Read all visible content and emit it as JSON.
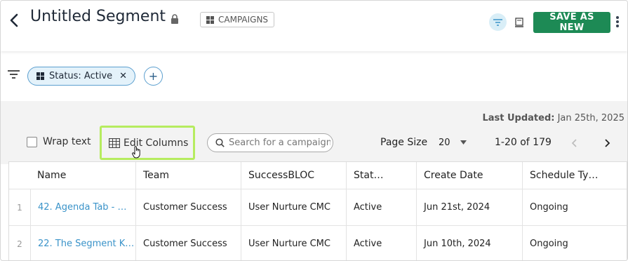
{
  "header": {
    "title": "Untitled Segment",
    "badge_label": "CAMPAIGNS",
    "save_label": "SAVE AS NEW"
  },
  "filters": {
    "chip_label": "Status: Active"
  },
  "toolbar": {
    "last_updated_label": "Last Updated:",
    "last_updated_value": "Jan 25th, 2025",
    "wrap_text_label": "Wrap text",
    "edit_columns_label": "Edit Columns",
    "search_placeholder": "Search for a campaign",
    "page_size_label": "Page Size",
    "page_size_value": "20",
    "range_label": "1-20 of 179"
  },
  "table": {
    "columns": [
      "Name",
      "Team",
      "SuccessBLOC",
      "Stat…",
      "Create Date",
      "Schedule Ty…"
    ],
    "rows": [
      {
        "index": "1",
        "name": "42. Agenda Tab - …",
        "team": "Customer Success",
        "bloc": "User Nurture CMC",
        "status": "Active",
        "date": "Jun 21st, 2024",
        "schedule": "Ongoing"
      },
      {
        "index": "2",
        "name": "22. The Segment K…",
        "team": "Customer Success",
        "bloc": "User Nurture CMC",
        "status": "Active",
        "date": "Jun 10th, 2024",
        "schedule": "Ongoing"
      }
    ]
  },
  "colors": {
    "save_button": "#1d8a55",
    "highlight_border": "#b6ec5f",
    "chip_bg": "#e4f2fa",
    "link": "#3a93c9"
  },
  "icons": [
    "back-arrow-icon",
    "lock-icon",
    "grid-icon",
    "filter-icon",
    "book-icon",
    "kebab-icon",
    "table-icon",
    "cursor-hand-icon",
    "search-icon",
    "chevron-down-icon",
    "chevron-left-icon",
    "chevron-right-icon",
    "close-icon",
    "plus-icon"
  ]
}
